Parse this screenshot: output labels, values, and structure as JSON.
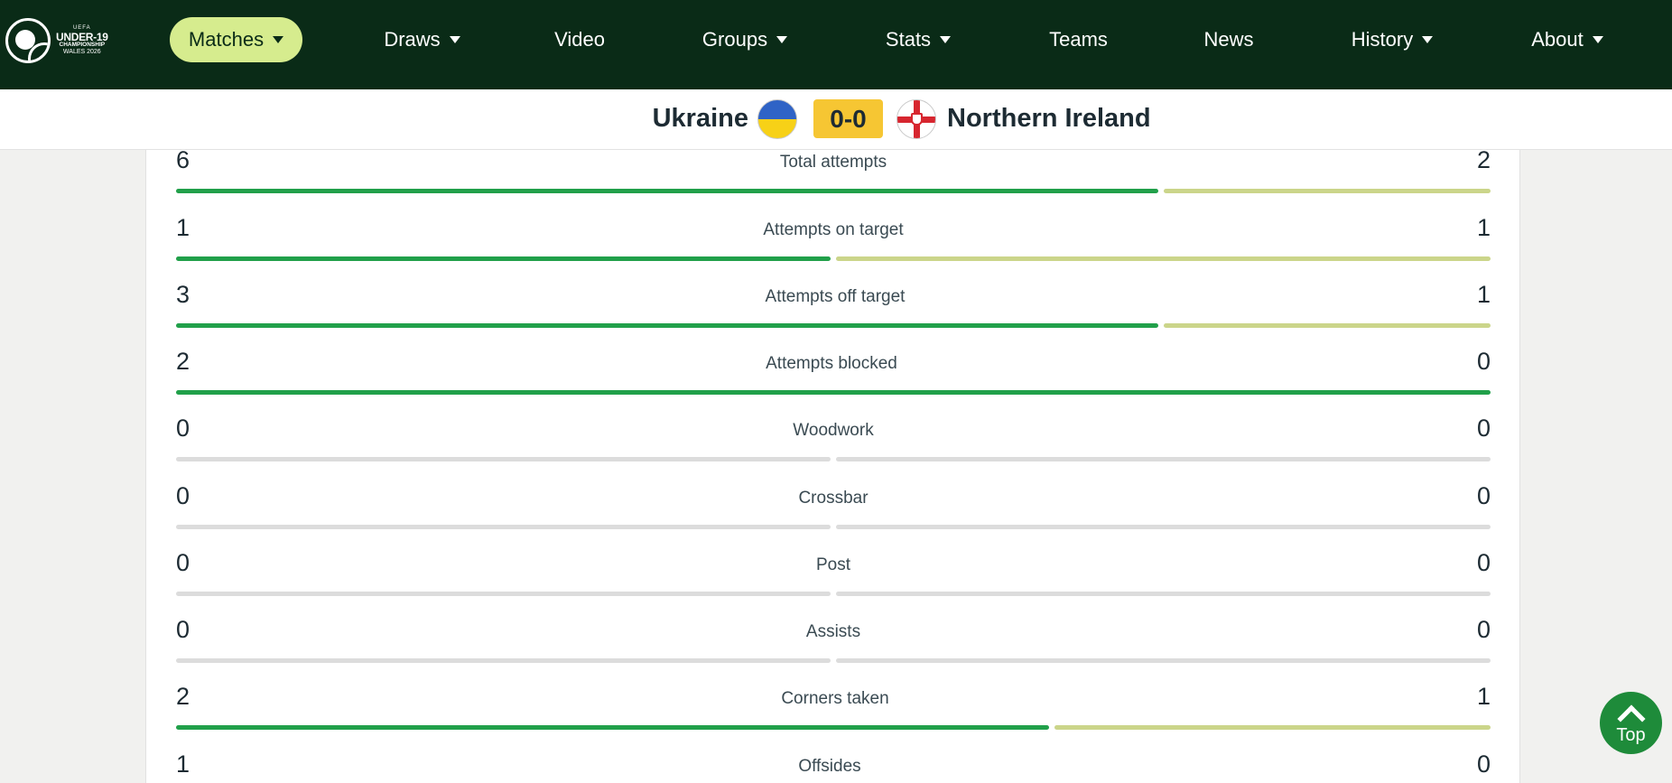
{
  "logo": {
    "line1": "UEFA",
    "line2": "UNDER-19",
    "line3": "CHAMPIONSHIP",
    "line4": "WALES 2026"
  },
  "nav": {
    "items": [
      {
        "label": "Matches",
        "dropdown": true,
        "active": true
      },
      {
        "label": "Draws",
        "dropdown": true
      },
      {
        "label": "Video",
        "dropdown": false
      },
      {
        "label": "Groups",
        "dropdown": true
      },
      {
        "label": "Stats",
        "dropdown": true
      },
      {
        "label": "Teams",
        "dropdown": false
      },
      {
        "label": "News",
        "dropdown": false
      },
      {
        "label": "History",
        "dropdown": true
      },
      {
        "label": "About",
        "dropdown": true
      }
    ]
  },
  "match": {
    "home_team": "Ukraine",
    "away_team": "Northern Ireland",
    "score": "0-0"
  },
  "stats": [
    {
      "label": "Total attempts",
      "home": "6",
      "away": "2"
    },
    {
      "label": "Attempts on target",
      "home": "1",
      "away": "1"
    },
    {
      "label": "Attempts off target",
      "home": "3",
      "away": "1"
    },
    {
      "label": "Attempts blocked",
      "home": "2",
      "away": "0"
    },
    {
      "label": "Woodwork",
      "home": "0",
      "away": "0"
    },
    {
      "label": "Crossbar",
      "home": "0",
      "away": "0"
    },
    {
      "label": "Post",
      "home": "0",
      "away": "0"
    },
    {
      "label": "Assists",
      "home": "0",
      "away": "0"
    },
    {
      "label": "Corners taken",
      "home": "2",
      "away": "1"
    },
    {
      "label": "Offsides",
      "home": "1",
      "away": "0"
    }
  ],
  "top_button": {
    "label": "Top"
  },
  "colors": {
    "nav_bg": "#0a2b17",
    "nav_active": "#d6ec8e",
    "score_bg": "#f6c633",
    "home_bar": "#21a04a",
    "away_bar": "#cbd58a",
    "empty_bar": "#dcdcdc",
    "top_button": "#1e8b3a"
  }
}
